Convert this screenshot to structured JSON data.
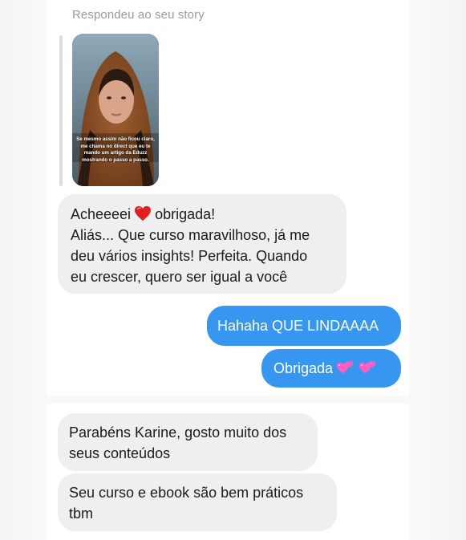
{
  "thread": {
    "story_caption": "Respondeu ao seu story",
    "story_overlay_text": "Se mesmo assim não ficou claro, me chama no direct que eu te mando um artigo da Eduzz mostrando o passo a passo."
  },
  "messages": [
    {
      "direction": "incoming",
      "lines": [
        "Acheeeei",
        "obrigada!",
        "Aliás... Que curso maravilhoso, já me",
        "deu vários insights! Perfeita. Quando",
        "eu crescer, quero ser igual a você"
      ],
      "icon": "red-heart-icon"
    },
    {
      "direction": "outgoing",
      "lines": [
        "Hahaha QUE LINDAAAA"
      ]
    },
    {
      "direction": "outgoing",
      "lines": [
        "Obrigada"
      ],
      "icon": "two-hearts-icon"
    },
    {
      "direction": "incoming",
      "lines": [
        "Parabéns Karine, gosto muito dos",
        "seus conteúdos"
      ]
    },
    {
      "direction": "incoming",
      "lines": [
        "Seu curso e ebook são bem práticos",
        "tbm"
      ]
    }
  ],
  "colors": {
    "incoming_bubble": "#efefef",
    "outgoing_bubble": "#3797f0",
    "caption_gray": "#9a9a9a",
    "heart_red": "#e0201f",
    "hearts_pink": "#ff5fc1"
  }
}
